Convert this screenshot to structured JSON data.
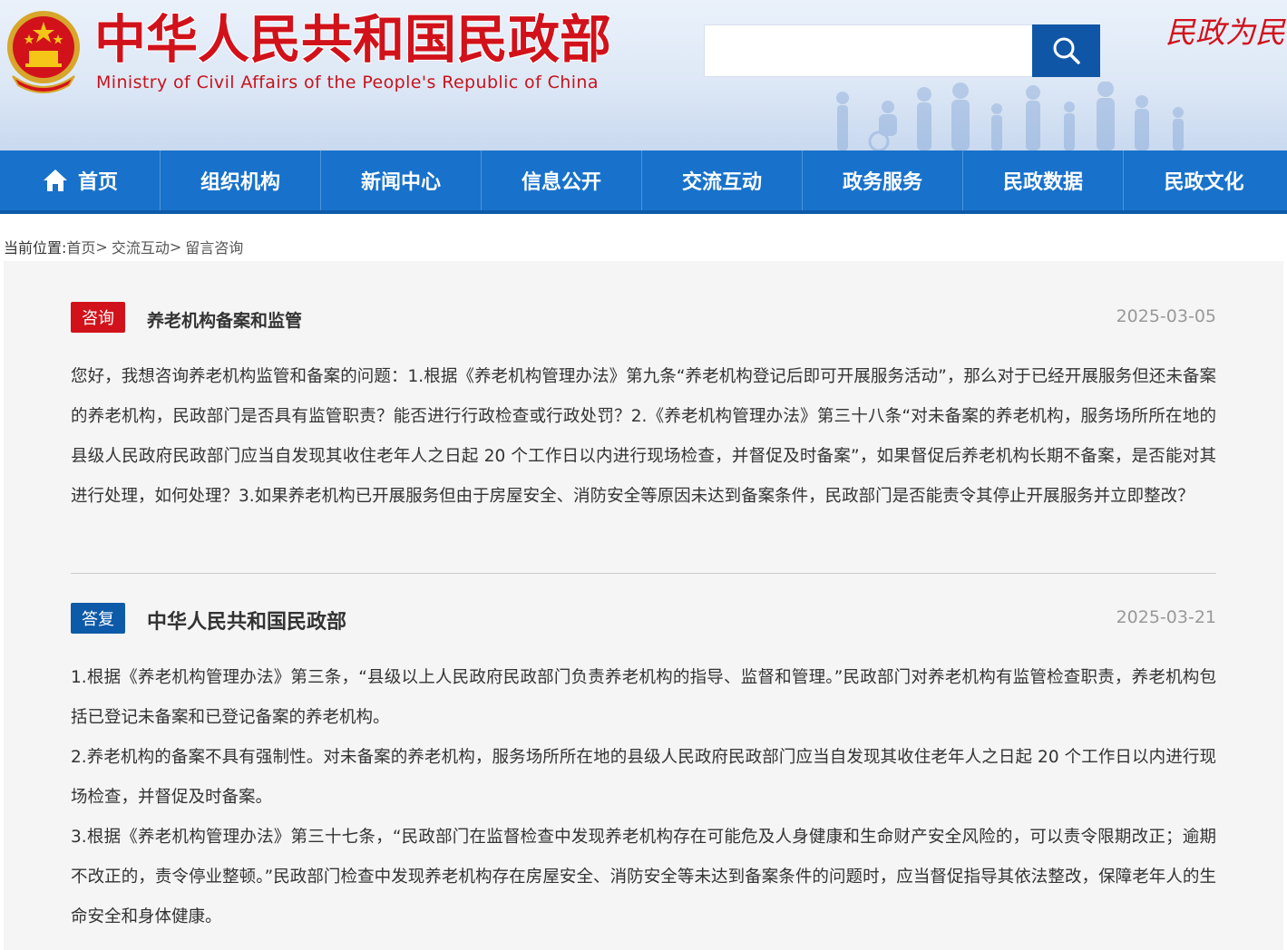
{
  "header": {
    "title_cn": "中华人民共和国民政部",
    "title_en": "Ministry of Civil Affairs of the People's Republic of China",
    "slogan": "民政为民",
    "search": {
      "placeholder": "",
      "button_icon": "search-icon"
    },
    "emblem_icon": "national-emblem-icon"
  },
  "nav": {
    "items": [
      {
        "label": "首页",
        "icon": "home-icon"
      },
      {
        "label": "组织机构"
      },
      {
        "label": "新闻中心"
      },
      {
        "label": "信息公开"
      },
      {
        "label": "交流互动"
      },
      {
        "label": "政务服务"
      },
      {
        "label": "民政数据"
      },
      {
        "label": "民政文化"
      }
    ]
  },
  "breadcrumb": {
    "prefix": "当前位置:",
    "items": [
      "首页",
      "交流互动",
      "留言咨询"
    ],
    "separator": ">"
  },
  "question": {
    "tag": "咨询",
    "title": "养老机构备案和监管",
    "date": "2025-03-05",
    "body": "您好，我想咨询养老机构监管和备案的问题：1.根据《养老机构管理办法》第九条“养老机构登记后即可开展服务活动”，那么对于已经开展服务但还未备案的养老机构，民政部门是否具有监管职责？能否进行行政检查或行政处罚？2.《养老机构管理办法》第三十八条“对未备案的养老机构，服务场所所在地的县级人民政府民政部门应当自发现其收住老年人之日起 20 个工作日以内进行现场检查，并督促及时备案”，如果督促后养老机构长期不备案，是否能对其进行处理，如何处理？3.如果养老机构已开展服务但由于房屋安全、消防安全等原因未达到备案条件，民政部门是否能责令其停止开展服务并立即整改？"
  },
  "answer": {
    "tag": "答复",
    "title": "中华人民共和国民政部",
    "date": "2025-03-21",
    "paragraphs": [
      " 1.根据《养老机构管理办法》第三条，“县级以上人民政府民政部门负责养老机构的指导、监督和管理。”民政部门对养老机构有监管检查职责，养老机构包括已登记未备案和已登记备案的养老机构。",
      "2.养老机构的备案不具有强制性。对未备案的养老机构，服务场所所在地的县级人民政府民政部门应当自发现其收住老年人之日起 20 个工作日以内进行现场检查，并督促及时备案。",
      "3.根据《养老机构管理办法》第三十七条，“民政部门在监督检查中发现养老机构存在可能危及人身健康和生命财产安全风险的，可以责令限期改正；逾期不改正的，责令停业整顿。”民政部门检查中发现养老机构存在房屋安全、消防安全等未达到备案条件的问题时，应当督促指导其依法整改，保障老年人的生命安全和身体健康。"
    ]
  },
  "colors": {
    "brand_red": "#d1121b",
    "nav_blue": "#1872cb",
    "answer_blue": "#0d5aa8"
  }
}
